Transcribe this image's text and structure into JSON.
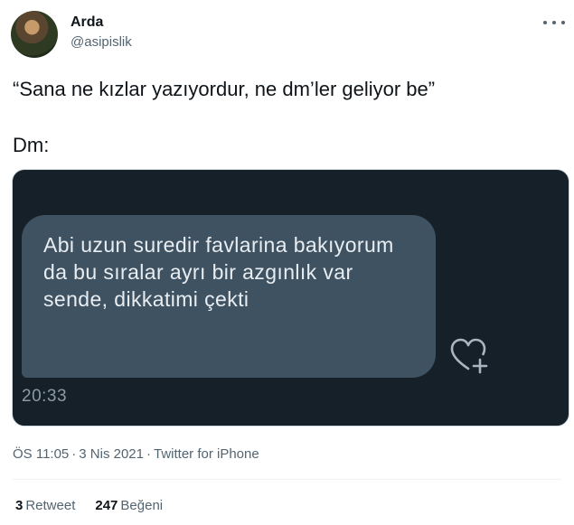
{
  "author": {
    "name": "Arda",
    "handle": "@asipislik"
  },
  "tweet": {
    "quote": "“Sana ne kızlar yazıyordur, ne dm’ler geliyor be”",
    "dm_label": "Dm:"
  },
  "dm_screenshot": {
    "message": "Abi uzun suredir favlarina bakıyorum da bu sıralar ayrı bir azgınlık var sende, dikkatimi çekti",
    "time": "20:33",
    "background_color": "#162029",
    "bubble_color": "#3f5262"
  },
  "meta": {
    "time": "ÖS 11:05",
    "date": "3 Nis 2021",
    "source": "Twitter for iPhone"
  },
  "stats": {
    "retweets_count": "3",
    "retweets_label": "Retweet",
    "likes_count": "247",
    "likes_label": "Beğeni"
  },
  "icons": {
    "more": "more-options-icon",
    "react": "heart-plus-icon"
  }
}
